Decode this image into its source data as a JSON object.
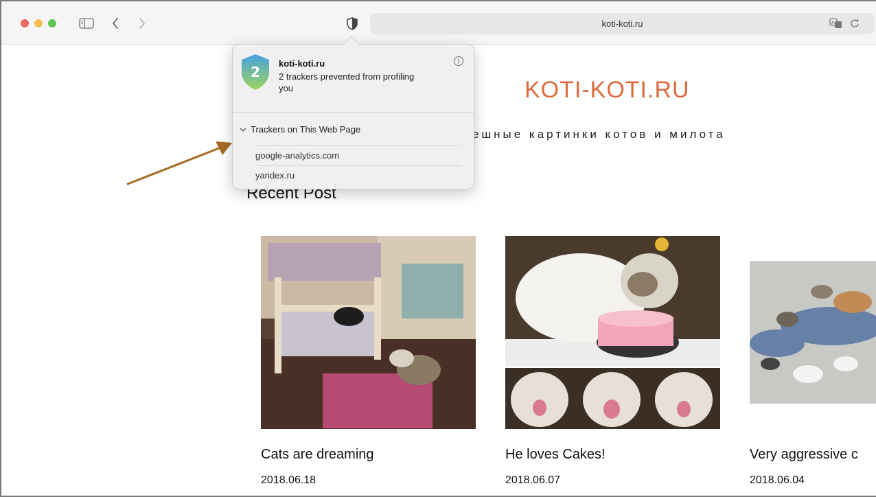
{
  "browser": {
    "url": "koti-koti.ru",
    "icons": [
      "sidebar-icon",
      "back-icon",
      "forward-icon",
      "privacy-shield-icon",
      "translate-icon",
      "reload-icon"
    ]
  },
  "site": {
    "title": "KOTI-KOTI.RU",
    "tagline": "ешные картинки котов и милота",
    "section_title": "Recent Post",
    "accent_color": "#dd6b3f",
    "posts": [
      {
        "title": "Cats are dreaming",
        "date": "2018.06.18"
      },
      {
        "title": "He loves Cakes!",
        "date": "2018.06.07"
      },
      {
        "title": "Very aggressive c",
        "date": "2018.06.04"
      }
    ]
  },
  "privacy_report": {
    "count": "2",
    "site": "koti-koti.ru",
    "message": "2 trackers prevented from profiling you",
    "section_label": "Trackers on This Web Page",
    "trackers": [
      "google-analytics.com",
      "yandex.ru"
    ]
  }
}
